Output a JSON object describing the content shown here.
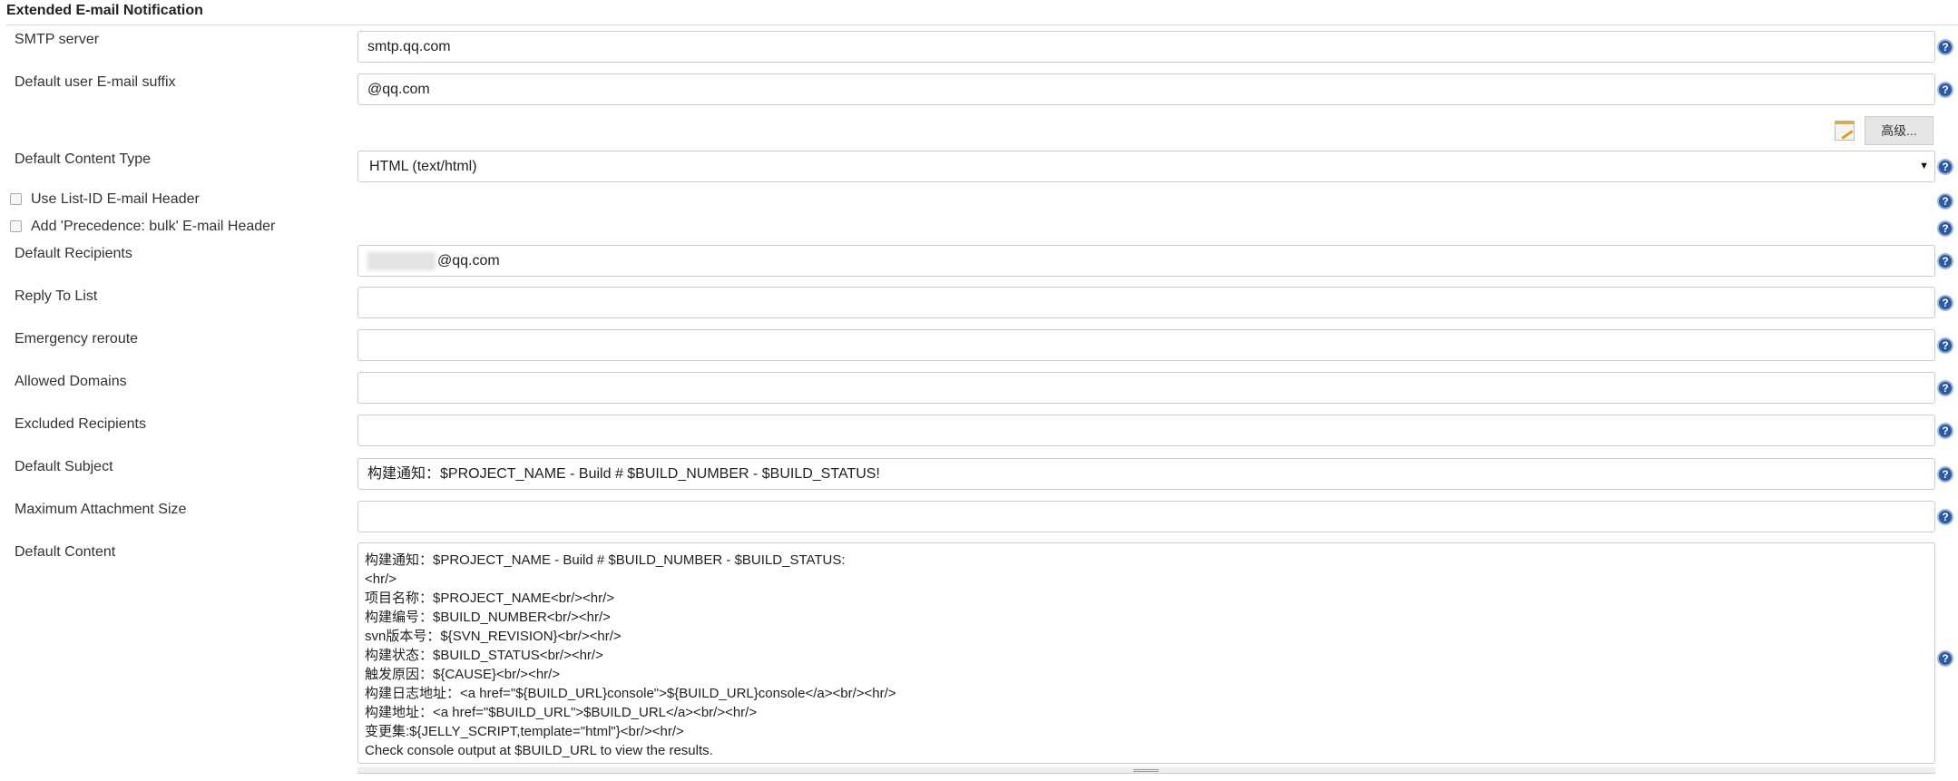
{
  "section_title": "Extended E-mail Notification",
  "fields": {
    "smtp_server": {
      "label": "SMTP server",
      "value": "smtp.qq.com"
    },
    "email_suffix": {
      "label": "Default user E-mail suffix",
      "value": "@qq.com"
    },
    "advanced_button": "高级...",
    "content_type": {
      "label": "Default Content Type",
      "value": "HTML (text/html)"
    },
    "use_list_id": {
      "label": "Use List-ID E-mail Header",
      "checked": false
    },
    "precedence_bulk": {
      "label": "Add 'Precedence: bulk' E-mail Header",
      "checked": false
    },
    "recipients": {
      "label": "Default Recipients",
      "value": "@qq.com"
    },
    "reply_to": {
      "label": "Reply To List",
      "value": ""
    },
    "emergency": {
      "label": "Emergency reroute",
      "value": ""
    },
    "allowed_domains": {
      "label": "Allowed Domains",
      "value": ""
    },
    "excluded": {
      "label": "Excluded Recipients",
      "value": ""
    },
    "subject": {
      "label": "Default Subject",
      "value": "构建通知：$PROJECT_NAME - Build # $BUILD_NUMBER - $BUILD_STATUS!"
    },
    "max_attachment": {
      "label": "Maximum Attachment Size",
      "value": ""
    },
    "content": {
      "label": "Default Content",
      "value": "构建通知：$PROJECT_NAME - Build # $BUILD_NUMBER - $BUILD_STATUS:\n<hr/>\n项目名称：$PROJECT_NAME<br/><hr/>\n构建编号：$BUILD_NUMBER<br/><hr/>\nsvn版本号：${SVN_REVISION}<br/><hr/>\n构建状态：$BUILD_STATUS<br/><hr/>\n触发原因：${CAUSE}<br/><hr/>\n构建日志地址：<a href=\"${BUILD_URL}console\">${BUILD_URL}console</a><br/><hr/>\n构建地址：<a href=\"$BUILD_URL\">$BUILD_URL</a><br/><hr/>\n变更集:${JELLY_SCRIPT,template=\"html\"}<br/><hr/>\nCheck console output at $BUILD_URL to view the results."
    }
  },
  "icons": {
    "help": "help-icon",
    "notepad": "notepad-icon",
    "dropdown": "chevron-down-icon"
  },
  "help_glyph": "?",
  "colors": {
    "help": "#2b5aa3",
    "button": "#e6e6e6"
  }
}
